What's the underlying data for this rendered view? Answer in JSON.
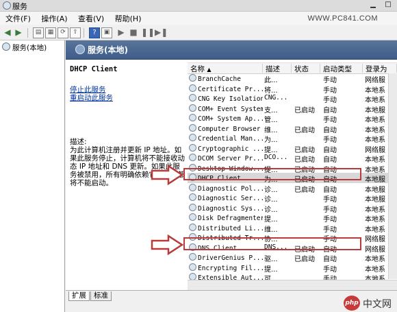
{
  "window": {
    "title": "服务"
  },
  "menu": [
    "文件(F)",
    "操作(A)",
    "查看(V)",
    "帮助(H)"
  ],
  "brand": "WWW.PC841.COM",
  "tree": {
    "root": "服务(本地)"
  },
  "panel": {
    "header": "服务(本地)"
  },
  "desc": {
    "service_name": "DHCP Client",
    "stop_link": "停止此服务",
    "restart_link": "重启动此服务",
    "label": "描述:",
    "text": "为此计算机注册并更新 IP 地址。如果此服务停止，计算机将不能接收动态 IP 地址和 DNS 更新。如果此服务被禁用，所有明确依赖它的服务都将不能启动。"
  },
  "columns": [
    "名称",
    "描述",
    "状态",
    "启动类型",
    "登录为"
  ],
  "rows": [
    {
      "name": "BranchCache",
      "desc": "此...",
      "status": "",
      "startup": "手动",
      "logon": "网络服"
    },
    {
      "name": "Certificate Pr...",
      "desc": "将...",
      "status": "",
      "startup": "手动",
      "logon": "本地系"
    },
    {
      "name": "CNG Key Isolation",
      "desc": "CNG...",
      "status": "",
      "startup": "手动",
      "logon": "本地系"
    },
    {
      "name": "COM+ Event System",
      "desc": "支...",
      "status": "已启动",
      "startup": "自动",
      "logon": "本地服"
    },
    {
      "name": "COM+ System Ap...",
      "desc": "管...",
      "status": "",
      "startup": "手动",
      "logon": "本地系"
    },
    {
      "name": "Computer Browser",
      "desc": "维...",
      "status": "已启动",
      "startup": "自动",
      "logon": "本地系"
    },
    {
      "name": "Credential Man...",
      "desc": "为...",
      "status": "",
      "startup": "手动",
      "logon": "本地系"
    },
    {
      "name": "Cryptographic ...",
      "desc": "提...",
      "status": "已启动",
      "startup": "自动",
      "logon": "网络服"
    },
    {
      "name": "DCOM Server Pr...",
      "desc": "DCO...",
      "status": "已启动",
      "startup": "自动",
      "logon": "本地系"
    },
    {
      "name": "Desktop Window...",
      "desc": "提...",
      "status": "已启动",
      "startup": "自动",
      "logon": "本地系"
    },
    {
      "name": "DHCP Client",
      "desc": "为...",
      "status": "已启动",
      "startup": "自动",
      "logon": "本地服"
    },
    {
      "name": "Diagnostic Pol...",
      "desc": "诊...",
      "status": "已启动",
      "startup": "自动",
      "logon": "本地服"
    },
    {
      "name": "Diagnostic Ser...",
      "desc": "诊...",
      "status": "",
      "startup": "手动",
      "logon": "本地服"
    },
    {
      "name": "Diagnostic Sys...",
      "desc": "诊...",
      "status": "",
      "startup": "手动",
      "logon": "本地系"
    },
    {
      "name": "Disk Defragmenter",
      "desc": "提...",
      "status": "",
      "startup": "手动",
      "logon": "本地系"
    },
    {
      "name": "Distributed Li...",
      "desc": "维...",
      "status": "",
      "startup": "手动",
      "logon": "本地系"
    },
    {
      "name": "Distributed Tr...",
      "desc": "协...",
      "status": "",
      "startup": "手动",
      "logon": "网络服"
    },
    {
      "name": "DNS Client",
      "desc": "DNS...",
      "status": "已启动",
      "startup": "自动",
      "logon": "网络服"
    },
    {
      "name": "DriverGenius P...",
      "desc": "驱...",
      "status": "已启动",
      "startup": "自动",
      "logon": "本地系"
    },
    {
      "name": "Encrypting Fil...",
      "desc": "提...",
      "status": "",
      "startup": "手动",
      "logon": "本地系"
    },
    {
      "name": "Extensible Aut...",
      "desc": "可...",
      "status": "",
      "startup": "手动",
      "logon": "本地系"
    }
  ],
  "tabs": [
    "扩展",
    "标准"
  ],
  "watermark": "中文网",
  "watermark_badge": "php",
  "colors": {
    "header_blue": "#4a6891",
    "highlight_red": "#b83a3a"
  }
}
